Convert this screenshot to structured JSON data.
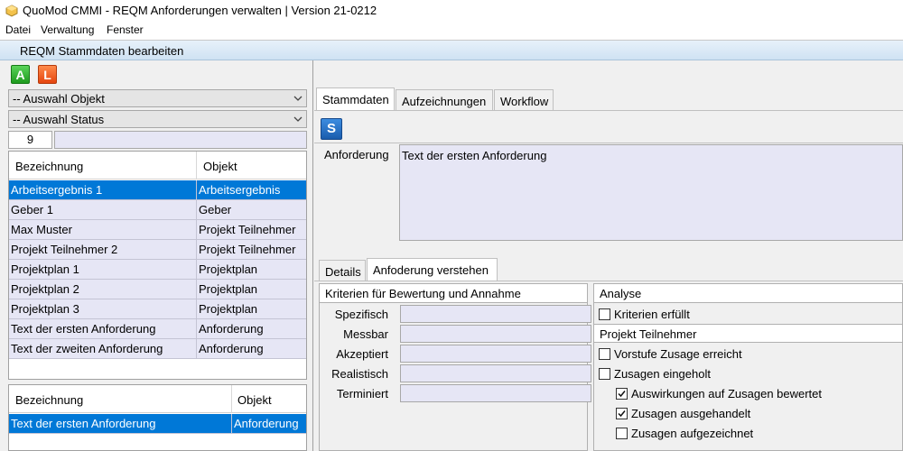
{
  "window": {
    "title": "QuoMod CMMI - REQM Anforderungen verwalten | Version 21-0212"
  },
  "menu": {
    "items": [
      "Datei",
      "Verwaltung",
      "Fenster"
    ]
  },
  "header": {
    "title": "REQM Stammdaten bearbeiten"
  },
  "left": {
    "btn_a": "A",
    "btn_l": "L",
    "combo_objekt": "-- Auswahl Objekt",
    "combo_status": "-- Auswahl Status",
    "count": "9",
    "grid1": {
      "col1": "Bezeichnung",
      "col2": "Objekt",
      "rows": [
        {
          "name": "Arbeitsergebnis 1",
          "obj": "Arbeitsergebnis"
        },
        {
          "name": "Geber 1",
          "obj": "Geber"
        },
        {
          "name": "Max Muster",
          "obj": "Projekt Teilnehmer"
        },
        {
          "name": "Projekt Teilnehmer 2",
          "obj": "Projekt Teilnehmer"
        },
        {
          "name": "Projektplan 1",
          "obj": "Projektplan"
        },
        {
          "name": "Projektplan 2",
          "obj": "Projektplan"
        },
        {
          "name": "Projektplan 3",
          "obj": "Projektplan"
        },
        {
          "name": "Text der ersten Anforderung",
          "obj": "Anforderung"
        },
        {
          "name": "Text der zweiten Anforderung",
          "obj": "Anforderung"
        }
      ]
    },
    "grid2": {
      "col1": "Bezeichnung",
      "col2": "Objekt",
      "rows": [
        {
          "name": "Text der ersten Anforderung",
          "obj": "Anforderung"
        }
      ]
    }
  },
  "right": {
    "tabs": [
      "Stammdaten",
      "Aufzeichnungen",
      "Workflow"
    ],
    "save_btn": "S",
    "anforderung_label": "Anforderung",
    "anforderung_text": "Text der ersten Anforderung",
    "inner_tabs": [
      "Details",
      "Anfoderung verstehen"
    ],
    "criteria": {
      "title": "Kriterien für Bewertung und Annahme",
      "labels": [
        "Spezifisch",
        "Messbar",
        "Akzeptiert",
        "Realistisch",
        "Terminiert"
      ]
    },
    "analyse": {
      "title": "Analyse",
      "kriterien": "Kriterien erfüllt",
      "kriterien_checked": false,
      "section2": "Projekt Teilnehmer",
      "vorstufe": "Vorstufe Zusage erreicht",
      "vorstufe_checked": false,
      "eingeholt": "Zusagen eingeholt",
      "eingeholt_checked": false,
      "auswirkungen": "Auswirkungen auf Zusagen bewertet",
      "auswirkungen_checked": true,
      "ausgehandelt": "Zusagen ausgehandelt",
      "ausgehandelt_checked": true,
      "aufgezeichnet": "Zusagen aufgezeichnet",
      "aufgezeichnet_checked": false
    }
  },
  "colors": {
    "selection": "#0078d7",
    "field": "#e6e6f5",
    "accent_a": "#1e9a1e",
    "accent_l": "#e5450f",
    "save": "#1a5cad"
  }
}
